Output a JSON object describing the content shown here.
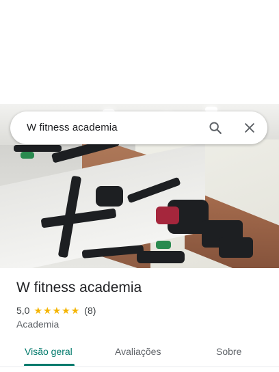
{
  "search": {
    "query": "W fitness academia",
    "search_icon": "search-icon",
    "close_icon": "close-icon"
  },
  "place": {
    "name": "W fitness academia",
    "rating": "5,0",
    "stars": 5,
    "review_count": "(8)",
    "category": "Academia"
  },
  "tabs": [
    {
      "label": "Visão geral",
      "active": true
    },
    {
      "label": "Avaliações",
      "active": false
    },
    {
      "label": "Sobre",
      "active": false
    }
  ],
  "colors": {
    "accent": "#00796b",
    "star": "#f4b400"
  }
}
